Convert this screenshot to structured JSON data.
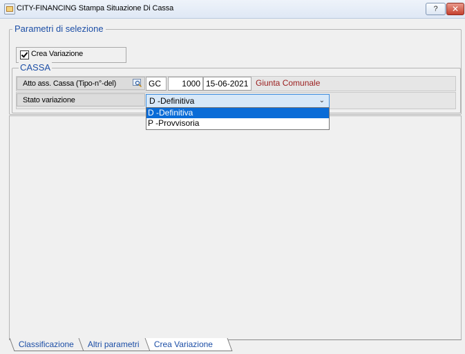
{
  "window": {
    "title": "CITY-FINANCING  Stampa Situazione Di Cassa",
    "help_label": "?",
    "close_label": "✕"
  },
  "selection_group": {
    "legend": "Parametri di selezione",
    "crea_variazione": {
      "label": "Crea Variazione",
      "checked": true
    }
  },
  "cassa": {
    "legend": "CASSA",
    "atto": {
      "label": "Atto ass. Cassa (Tipo-n°-del)",
      "lookup_icon": "search-icon",
      "tipo": "GC",
      "numero": "1000",
      "data": "15-06-2021",
      "descrizione": "Giunta Comunale"
    },
    "stato": {
      "label": "Stato variazione",
      "selected": "D -Definitiva",
      "options": [
        "D -Definitiva",
        "P -Provvisoria"
      ]
    }
  },
  "tabs": [
    {
      "label": "Classificazione"
    },
    {
      "label": "Altri parametri"
    },
    {
      "label": "Crea Variazione",
      "active": true
    }
  ],
  "colors": {
    "legend": "#1c4ea6",
    "description_red": "#9a1c1c",
    "selection": "#0a6cd7"
  }
}
